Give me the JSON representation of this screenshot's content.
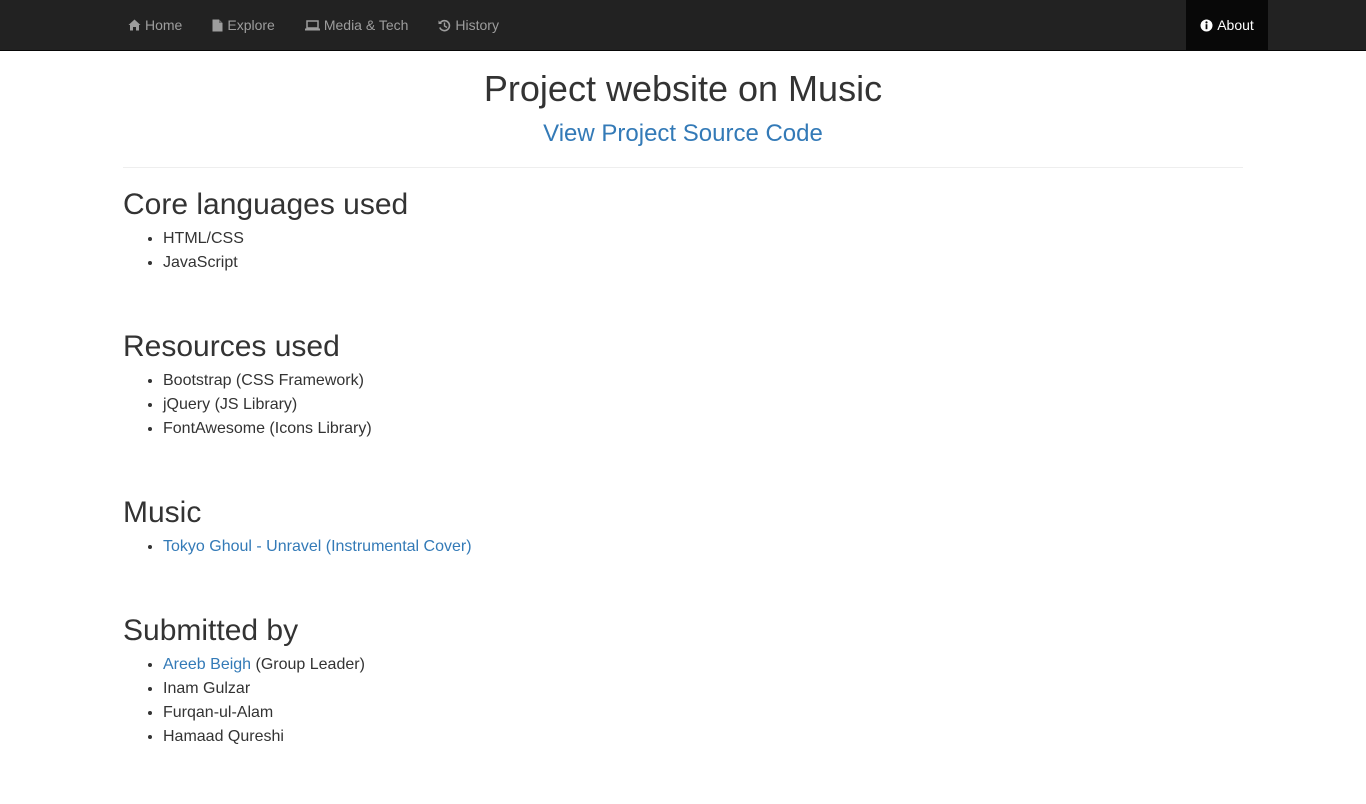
{
  "navbar": {
    "items": [
      {
        "label": "Home",
        "icon": "home-icon"
      },
      {
        "label": "Explore",
        "icon": "file-icon"
      },
      {
        "label": "Media & Tech",
        "icon": "laptop-icon"
      },
      {
        "label": "History",
        "icon": "history-icon"
      }
    ],
    "active": {
      "label": "About",
      "icon": "info-circle-icon"
    },
    "colors": {
      "background": "#222222",
      "text": "#9d9d9d",
      "active_background": "#080808",
      "active_text": "#ffffff"
    }
  },
  "header": {
    "title": "Project website on Music",
    "source_link": "View Project Source Code"
  },
  "sections": {
    "core": {
      "heading": "Core languages used",
      "items": [
        "HTML/CSS",
        "JavaScript"
      ]
    },
    "resources": {
      "heading": "Resources used",
      "items": [
        "Bootstrap (CSS Framework)",
        "jQuery (JS Library)",
        "FontAwesome (Icons Library)"
      ]
    },
    "music": {
      "heading": "Music",
      "items": [
        {
          "link": "Tokyo Ghoul - Unravel (Instrumental Cover)"
        }
      ]
    },
    "submitted": {
      "heading": "Submitted by",
      "leader": {
        "link": "Areeb Beigh",
        "suffix": " (Group Leader)"
      },
      "members": [
        "Inam Gulzar",
        "Furqan-ul-Alam",
        "Hamaad Qureshi"
      ]
    }
  },
  "colors": {
    "link": "#337ab7",
    "text": "#333333",
    "divider": "#eeeeee"
  }
}
